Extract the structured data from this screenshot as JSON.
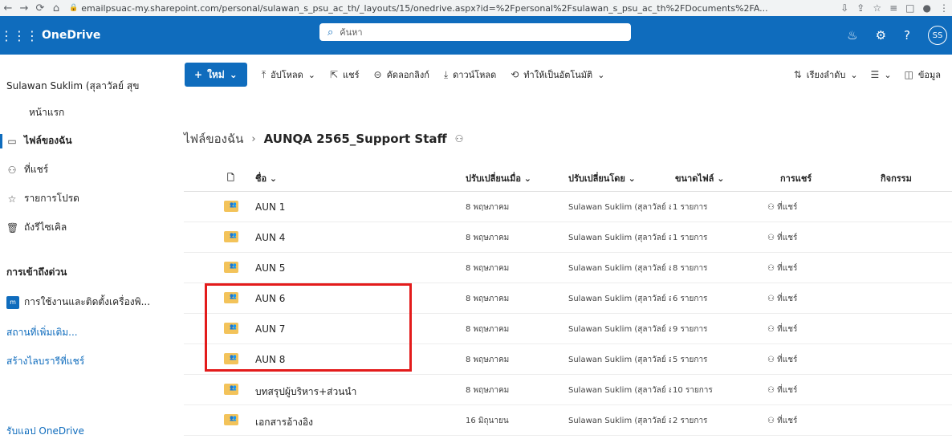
{
  "browser": {
    "url": "emailpsuac-my.sharepoint.com/personal/sulawan_s_psu_ac_th/_layouts/15/onedrive.aspx?id=%2Fpersonal%2Fsulawan_s_psu_ac_th%2FDocuments%2FA..."
  },
  "suite": {
    "app_name": "OneDrive",
    "search_placeholder": "ค้นหา",
    "avatar_initials": "SS"
  },
  "leftnav": {
    "user": "Sulawan Suklim (สุลาวัลย์ สุข",
    "home": "หน้าแรก",
    "items": [
      {
        "label": "ไฟล์ของฉัน",
        "icon": "folder-icon"
      },
      {
        "label": "ที่แชร์",
        "icon": "people-icon"
      },
      {
        "label": "รายการโปรด",
        "icon": "star-icon"
      },
      {
        "label": "ถังรีไซเคิล",
        "icon": "trash-icon"
      }
    ],
    "quick_access_title": "การเข้าถึงด่วน",
    "quick_item": "การใช้งานและติดตั้งเครื่องพิ...",
    "more_places": "สถานที่เพิ่มเติม...",
    "create_library": "สร้างไลบรารีที่แชร์",
    "get_app": "รับแอป OneDrive"
  },
  "cmdbar": {
    "new": "ใหม่",
    "upload": "อัปโหลด",
    "share": "แชร์",
    "copy_link": "คัดลอกลิงก์",
    "download": "ดาวน์โหลด",
    "automate": "ทำให้เป็นอัตโนมัติ",
    "sort": "เรียงลำดับ",
    "details": "ข้อมูล"
  },
  "breadcrumb": {
    "root": "ไฟล์ของฉัน",
    "current": "AUNQA 2565_Support Staff"
  },
  "columns": {
    "name": "ชื่อ",
    "modified": "ปรับเปลี่ยนเมื่อ",
    "modified_by": "ปรับเปลี่ยนโดย",
    "size": "ขนาดไฟล์",
    "sharing": "การแชร์",
    "activity": "กิจกรรม"
  },
  "files": [
    {
      "name": "AUN 1",
      "modified": "8 พฤษภาคม",
      "by": "Sulawan Suklim (สุลาวัลย์ ส",
      "size": "1 รายการ",
      "sharing": "ที่แชร์"
    },
    {
      "name": "AUN 4",
      "modified": "8 พฤษภาคม",
      "by": "Sulawan Suklim (สุลาวัลย์ ส",
      "size": "1 รายการ",
      "sharing": "ที่แชร์"
    },
    {
      "name": "AUN 5",
      "modified": "8 พฤษภาคม",
      "by": "Sulawan Suklim (สุลาวัลย์ ส",
      "size": "8 รายการ",
      "sharing": "ที่แชร์"
    },
    {
      "name": "AUN 6",
      "modified": "8 พฤษภาคม",
      "by": "Sulawan Suklim (สุลาวัลย์ ส",
      "size": "6 รายการ",
      "sharing": "ที่แชร์"
    },
    {
      "name": "AUN 7",
      "modified": "8 พฤษภาคม",
      "by": "Sulawan Suklim (สุลาวัลย์ ส",
      "size": "9 รายการ",
      "sharing": "ที่แชร์"
    },
    {
      "name": "AUN 8",
      "modified": "8 พฤษภาคม",
      "by": "Sulawan Suklim (สุลาวัลย์ ส",
      "size": "5 รายการ",
      "sharing": "ที่แชร์"
    },
    {
      "name": "บทสรุปผู้บริหาร+ส่วนนำ",
      "modified": "8 พฤษภาคม",
      "by": "Sulawan Suklim (สุลาวัลย์ ส",
      "size": "10 รายการ",
      "sharing": "ที่แชร์"
    },
    {
      "name": "เอกสารอ้างอิง",
      "modified": "16 มิถุนายน",
      "by": "Sulawan Suklim (สุลาวัลย์ ส",
      "size": "2 รายการ",
      "sharing": "ที่แชร์"
    }
  ],
  "colors": {
    "accent": "#0f6cbd",
    "highlight": "#e31b1b",
    "folder": "#f3c35a"
  }
}
